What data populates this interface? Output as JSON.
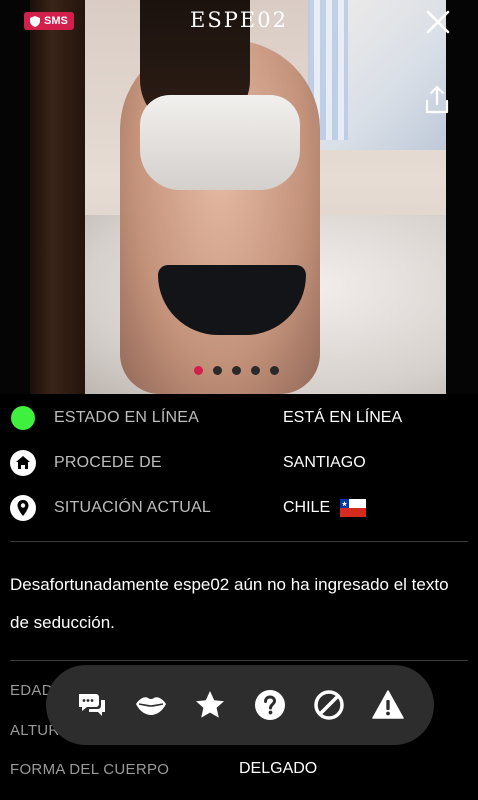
{
  "header": {
    "title": "ESPE02",
    "sms_badge": "SMS",
    "close_icon": "close-icon",
    "share_icon": "share-icon"
  },
  "carousel": {
    "total": 5,
    "active_index": 0,
    "accent_color": "#d31f4b"
  },
  "status": {
    "rows": [
      {
        "icon": "online-status-dot",
        "label": "ESTADO EN LÍNEA",
        "value": "ESTÁ EN LÍNEA"
      },
      {
        "icon": "home-icon",
        "label": "PROCEDE DE",
        "value": "SANTIAGO"
      },
      {
        "icon": "location-pin-icon",
        "label": "SITUACIÓN ACTUAL",
        "value": "CHILE",
        "flag": "chile-flag-icon"
      }
    ],
    "online_color": "#3ff03f"
  },
  "description": "Desafortunadamente espe02 aún no ha ingresado el texto de seducción.",
  "details": {
    "rows": [
      {
        "label": "EDAD",
        "value": ""
      },
      {
        "label": "ALTURA",
        "value": ""
      },
      {
        "label": "FORMA DEL CUERPO",
        "value": "DELGADO"
      }
    ]
  },
  "actions": [
    {
      "icon": "chat-icon"
    },
    {
      "icon": "kiss-lips-icon"
    },
    {
      "icon": "star-icon"
    },
    {
      "icon": "help-icon"
    },
    {
      "icon": "block-icon"
    },
    {
      "icon": "report-warning-icon"
    }
  ]
}
